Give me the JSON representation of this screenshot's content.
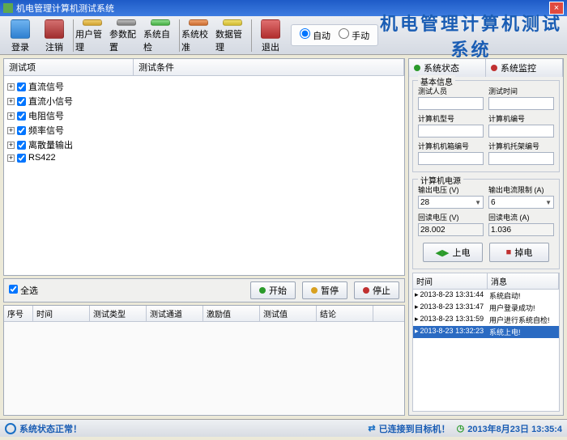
{
  "window": {
    "title": "机电管理计算机测试系统"
  },
  "toolbar": {
    "login": "登录",
    "logout": "注销",
    "usermgr": "用户管理",
    "paramcfg": "参数配置",
    "syscheck": "系统自检",
    "syscal": "系统校准",
    "datamgr": "数据管理",
    "exit": "退出"
  },
  "mode": {
    "auto": "自动",
    "manual": "手动"
  },
  "maintitle": "机电管理计算机测试系统",
  "tree": {
    "col_item": "测试项",
    "col_cond": "测试条件",
    "items": [
      "直流信号",
      "直流小信号",
      "电阻信号",
      "频率信号",
      "离散量输出",
      "RS422"
    ]
  },
  "actions": {
    "selall": "全选",
    "start": "开始",
    "pause": "暂停",
    "stop": "停止"
  },
  "grid": {
    "cols": [
      "序号",
      "时间",
      "测试类型",
      "测试通道",
      "激励值",
      "测试值",
      "结论"
    ]
  },
  "tabs": {
    "status": "系统状态",
    "monitor": "系统监控"
  },
  "basic": {
    "title": "基本信息",
    "tester": "测试人员",
    "testtime": "测试时间",
    "model": "计算机型号",
    "pcid": "计算机编号",
    "caseid": "计算机机箱编号",
    "rackid": "计算机托架编号"
  },
  "power": {
    "title": "计算机电源",
    "out_v_label": "输出电压 (V)",
    "out_v": "28",
    "out_a_label": "输出电流限制 (A)",
    "out_a": "6",
    "read_v_label": "回读电压 (V)",
    "read_v": "28.002",
    "read_a_label": "回读电流 (A)",
    "read_a": "1.036",
    "on": "上电",
    "off": "掉电"
  },
  "log": {
    "col_time": "时间",
    "col_msg": "消息",
    "rows": [
      {
        "time": "2013-8-23 13:31:44",
        "msg": "系统启动!"
      },
      {
        "time": "2013-8-23 13:31:47",
        "msg": "用户登录成功!"
      },
      {
        "time": "2013-8-23 13:31:59",
        "msg": "用户进行系统自检!"
      },
      {
        "time": "2013-8-23 13:32:23",
        "msg": "系统上电!"
      }
    ]
  },
  "status": {
    "normal": "系统状态正常！",
    "connected": "已连接到目标机！",
    "datetime": "2013年8月23日  13:35:4"
  }
}
